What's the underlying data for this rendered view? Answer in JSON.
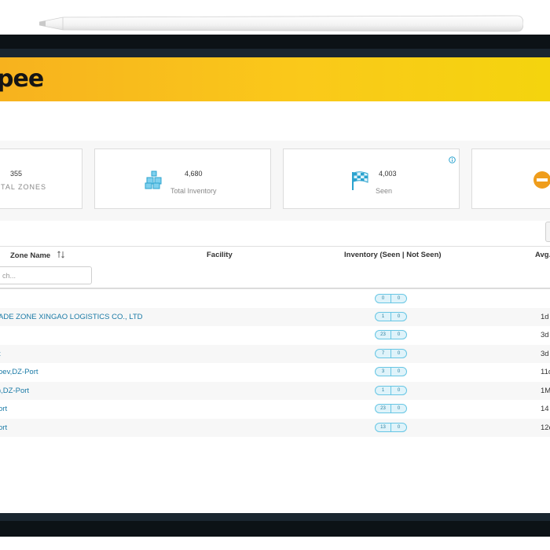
{
  "app": {
    "logo_text": "pee",
    "brand_color": "#f7c21b"
  },
  "stats": {
    "zones": {
      "value": "355",
      "label": "TAL ZONES"
    },
    "inventory": {
      "value": "4,680",
      "label": "Total Inventory",
      "icon": "boxes-icon"
    },
    "seen": {
      "value": "4,003",
      "label": "Seen",
      "icon": "checkered-flag-icon"
    },
    "fourth": {
      "icon": "minus-circle-icon"
    }
  },
  "table": {
    "headers": {
      "zone": "Zone Name",
      "facility": "Facility",
      "inventory": "Inventory (Seen | Not Seen)",
      "avg": "Avg."
    },
    "search_placeholder": "ch...",
    "rows": [
      {
        "zone": "",
        "seen": "0",
        "not_seen": "0",
        "avg": ""
      },
      {
        "zone": "ADE ZONE XINGAO LOGISTICS CO., LTD",
        "seen": "1",
        "not_seen": "0",
        "avg": "1d"
      },
      {
        "zone": "",
        "seen": "23",
        "not_seen": "0",
        "avg": "3d"
      },
      {
        "zone": "t",
        "seen": "7",
        "not_seen": "0",
        "avg": "3d"
      },
      {
        "zone": "oev,DZ-Port",
        "seen": "3",
        "not_seen": "0",
        "avg": "11d"
      },
      {
        "zone": "),DZ-Port",
        "seen": "1",
        "not_seen": "0",
        "avg": "1M"
      },
      {
        "zone": "ort",
        "seen": "23",
        "not_seen": "0",
        "avg": "14"
      },
      {
        "zone": "ort",
        "seen": "13",
        "not_seen": "0",
        "avg": "12d"
      }
    ]
  }
}
